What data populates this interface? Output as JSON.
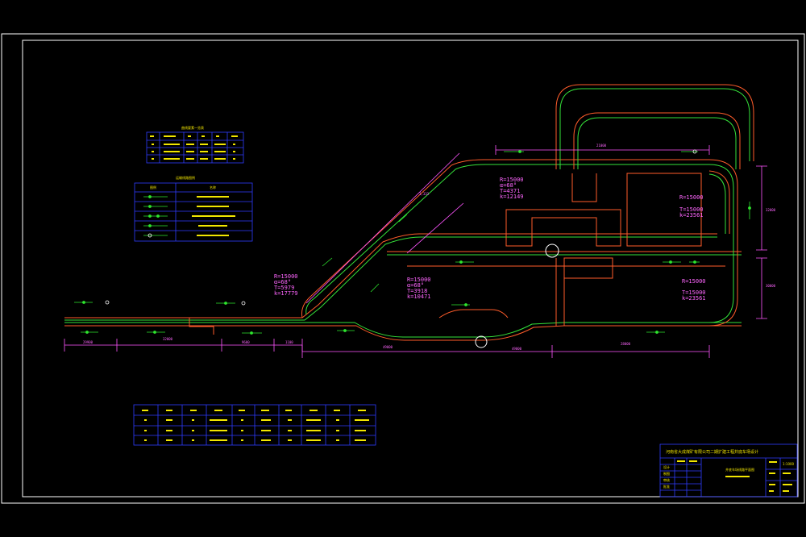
{
  "colors": {
    "background": "#000000",
    "frame": "#ffffff",
    "rail_outer": "#ff5c2a",
    "rail_inner": "#35e23a",
    "dimension": "#ff55ff",
    "table_line": "#2f3bff",
    "table_text": "#f2e600",
    "arrow": "#2ee62e"
  },
  "curve_annotations": [
    {
      "r": "R=15000",
      "a": "α=68°",
      "t": "T=5979",
      "k": "k=17779"
    },
    {
      "r": "R=15000",
      "a": "α=68°",
      "t": "T=3918",
      "k": "k=10471"
    },
    {
      "r": "R=15000",
      "a": "α=68°",
      "t": "T=4371",
      "k": "k=12149"
    },
    {
      "r": "R=15000",
      "a": "",
      "t": "T=15000",
      "k": "k=23561"
    },
    {
      "r": "R=15000",
      "a": "",
      "t": "T=15000",
      "k": "k=23561"
    }
  ],
  "tables": {
    "curve_table_title": "曲线要素一览表",
    "legend_title": "运输线路图例",
    "legend_headers": [
      "图例",
      "名称"
    ]
  },
  "title_block": {
    "project": "河南省大成煤矿有限公司二期扩建工程井底车场设计",
    "drawing_name": "井底车场线路平面图",
    "labels": [
      "设计",
      "制图",
      "审核",
      "批准"
    ],
    "scale": "1:1000"
  }
}
